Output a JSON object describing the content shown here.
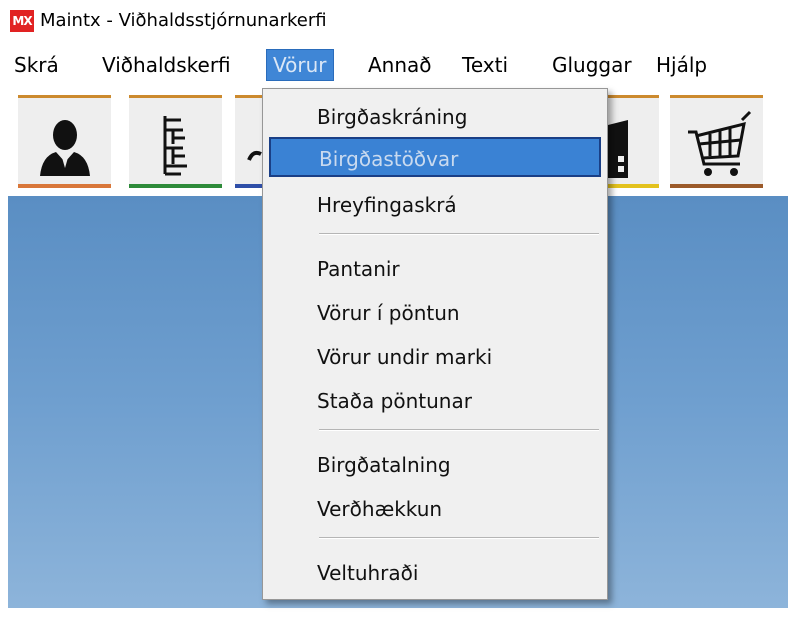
{
  "window": {
    "logo_text": "MX",
    "title": "Maintx - Viðhaldsstjórnunarkerfi"
  },
  "menubar": {
    "items": [
      {
        "label": "Skrá"
      },
      {
        "label": "Viðhaldskerfi"
      },
      {
        "label": "Vörur",
        "active": true
      },
      {
        "label": "Annað"
      },
      {
        "label": "Texti"
      },
      {
        "label": "Gluggar"
      },
      {
        "label": "Hjálp"
      }
    ]
  },
  "toolbar": {
    "buttons": [
      {
        "icon": "user-icon",
        "accent": "#d9773a"
      },
      {
        "icon": "tree-structure-icon",
        "accent": "#2e8b3a"
      },
      {
        "icon": "tool-icon",
        "accent": "#2f4fa8"
      },
      {
        "icon": "building-icon",
        "accent": "#e3c21d"
      },
      {
        "icon": "shopping-cart-icon",
        "accent": "#9b5a2a"
      }
    ]
  },
  "dropdown": {
    "menu": "Vörur",
    "items": [
      {
        "label": "Birgðaskráning"
      },
      {
        "label": "Birgðastöðvar",
        "highlighted": true
      },
      {
        "label": "Hreyfingaskrá"
      },
      {
        "label": "Pantanir"
      },
      {
        "label": "Vörur í pöntun"
      },
      {
        "label": "Vörur undir marki"
      },
      {
        "label": "Staða pöntunar"
      },
      {
        "label": "Birgðatalning"
      },
      {
        "label": "Verðhækkun"
      },
      {
        "label": "Veltuhraði"
      }
    ]
  },
  "colors": {
    "menu_highlight": "#3a82d4",
    "workspace": "#6f9fcf"
  }
}
